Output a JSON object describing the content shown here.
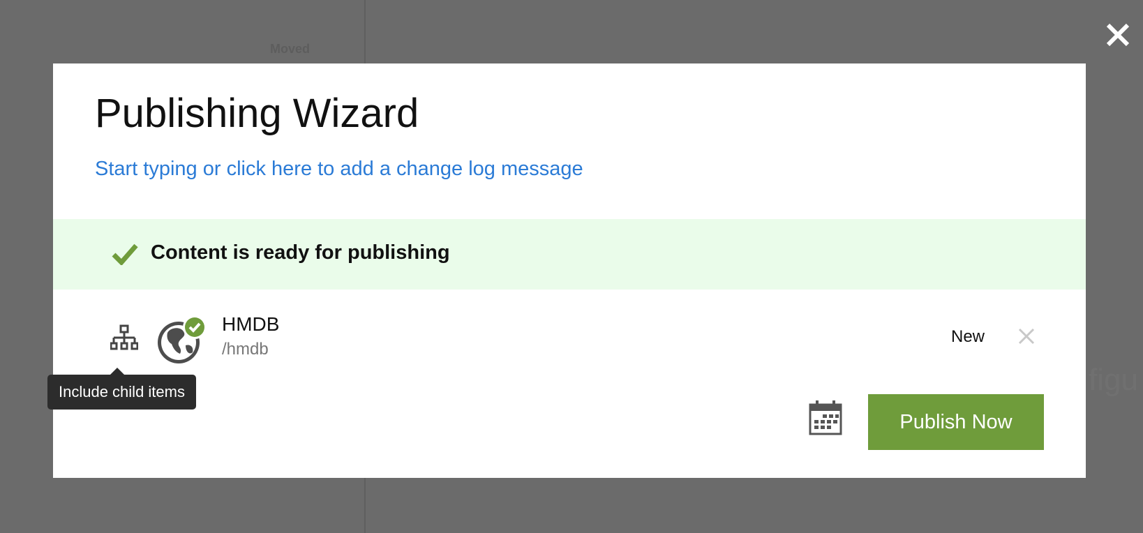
{
  "background": {
    "column_label": "Moved",
    "right_fragment": "figu"
  },
  "modal": {
    "close_icon": "close-icon",
    "title": "Publishing Wizard",
    "changelog_placeholder": "Start typing or click here to add a change log message",
    "status_banner": {
      "icon": "checkmark-icon",
      "text": "Content is ready for publishing",
      "color": "#eafcea"
    },
    "items": [
      {
        "name": "HMDB",
        "path": "/hmdb",
        "status": "New",
        "icons": [
          "sitemap-icon",
          "globe-icon",
          "check-badge-icon"
        ]
      }
    ],
    "tooltip": "Include child items",
    "schedule_icon": "calendar-icon",
    "publish_button": "Publish Now"
  },
  "colors": {
    "overlay": "#6b6b6b",
    "link": "#2b7bd6",
    "accent_green": "#6f9c3b"
  }
}
